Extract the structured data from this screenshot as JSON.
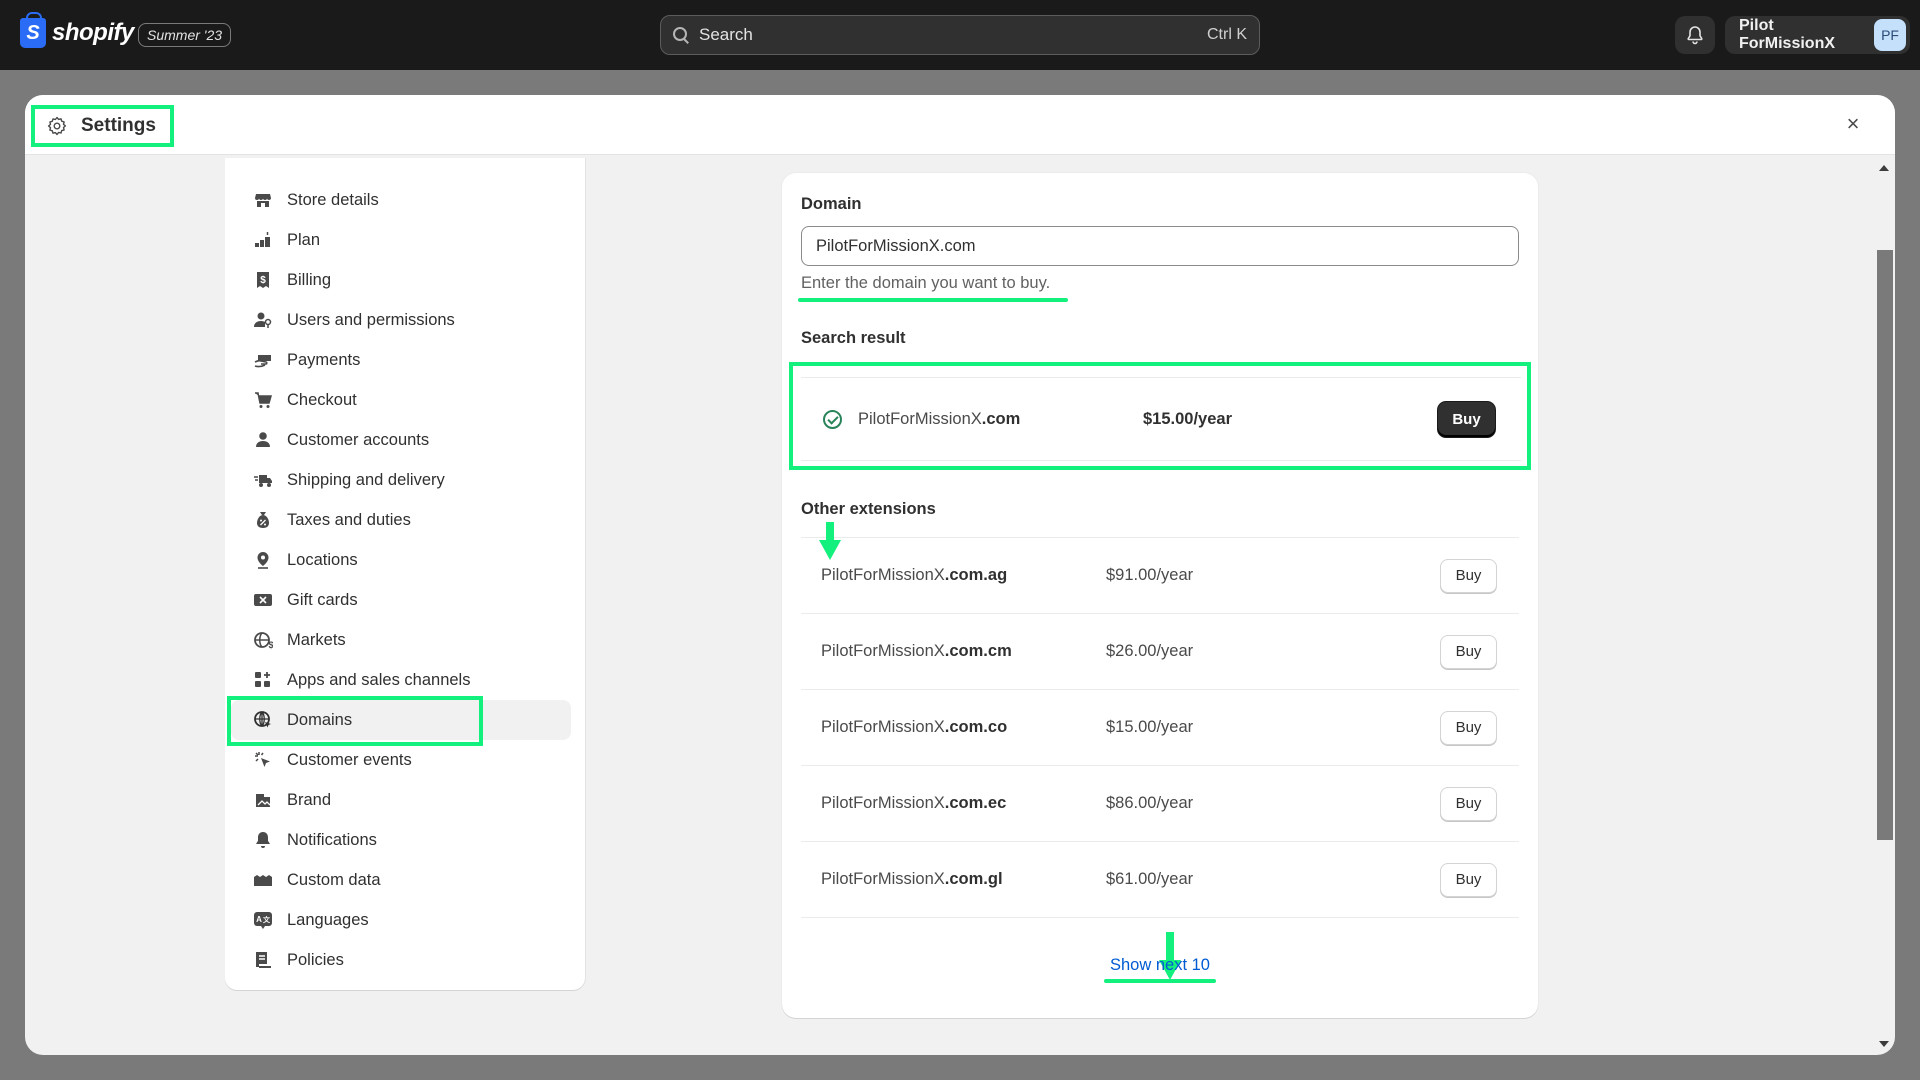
{
  "topbar": {
    "brand": "shopify",
    "brand_logo_letter": "S",
    "edition_badge": "Summer '23",
    "search_placeholder": "Search",
    "search_shortcut": "Ctrl K",
    "user_name": "Pilot ForMissionX",
    "user_initials": "PF"
  },
  "modal": {
    "title": "Settings",
    "close_symbol": "×"
  },
  "sidebar": {
    "active": "Domains",
    "items": [
      {
        "label": "Store details",
        "icon": "store-icon"
      },
      {
        "label": "Plan",
        "icon": "plan-icon"
      },
      {
        "label": "Billing",
        "icon": "billing-icon"
      },
      {
        "label": "Users and permissions",
        "icon": "users-icon"
      },
      {
        "label": "Payments",
        "icon": "payments-icon"
      },
      {
        "label": "Checkout",
        "icon": "cart-icon"
      },
      {
        "label": "Customer accounts",
        "icon": "person-icon"
      },
      {
        "label": "Shipping and delivery",
        "icon": "truck-icon"
      },
      {
        "label": "Taxes and duties",
        "icon": "tax-bag-icon"
      },
      {
        "label": "Locations",
        "icon": "location-pin-icon"
      },
      {
        "label": "Gift cards",
        "icon": "gift-card-icon"
      },
      {
        "label": "Markets",
        "icon": "globe-dollar-icon"
      },
      {
        "label": "Apps and sales channels",
        "icon": "apps-icon"
      },
      {
        "label": "Domains",
        "icon": "globe-cursor-icon"
      },
      {
        "label": "Customer events",
        "icon": "cursor-click-icon"
      },
      {
        "label": "Brand",
        "icon": "brand-icon"
      },
      {
        "label": "Notifications",
        "icon": "bell-icon"
      },
      {
        "label": "Custom data",
        "icon": "custom-data-icon"
      },
      {
        "label": "Languages",
        "icon": "language-icon"
      },
      {
        "label": "Policies",
        "icon": "policy-icon"
      }
    ]
  },
  "domain_form": {
    "label": "Domain",
    "value": "PilotForMissionX.com",
    "help_text": "Enter the domain you want to buy."
  },
  "search_result": {
    "title": "Search result",
    "domain_base": "PilotForMissionX",
    "domain_ext": ".com",
    "price": "$15.00/year",
    "status_icon": "check-circle-icon",
    "buy_label": "Buy"
  },
  "other_extensions": {
    "title": "Other extensions",
    "buy_label": "Buy",
    "rows": [
      {
        "base": "PilotForMissionX",
        "ext": ".com.ag",
        "price": "$91.00/year"
      },
      {
        "base": "PilotForMissionX",
        "ext": ".com.cm",
        "price": "$26.00/year"
      },
      {
        "base": "PilotForMissionX",
        "ext": ".com.co",
        "price": "$15.00/year"
      },
      {
        "base": "PilotForMissionX",
        "ext": ".com.ec",
        "price": "$86.00/year"
      },
      {
        "base": "PilotForMissionX",
        "ext": ".com.gl",
        "price": "$61.00/year"
      }
    ],
    "show_more_label": "Show next 10"
  },
  "annotation_color": "#13f07e"
}
